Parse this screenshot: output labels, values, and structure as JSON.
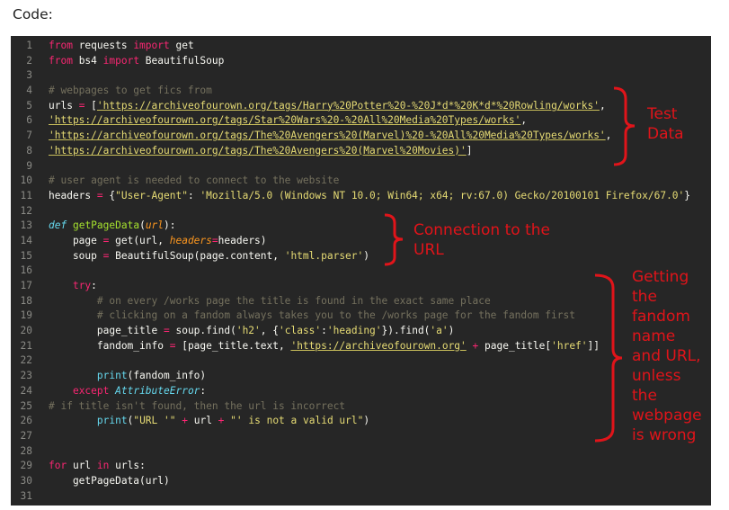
{
  "heading": "Code:",
  "code_lines": [
    [
      [
        "k",
        "from"
      ],
      [
        "t",
        " requests "
      ],
      [
        "k",
        "import"
      ],
      [
        "t",
        " get"
      ]
    ],
    [
      [
        "k",
        "from"
      ],
      [
        "t",
        " bs4 "
      ],
      [
        "k",
        "import"
      ],
      [
        "t",
        " BeautifulSoup"
      ]
    ],
    [],
    [
      [
        "c",
        "# webpages to get fics from"
      ]
    ],
    [
      [
        "t",
        "urls "
      ],
      [
        "k",
        "="
      ],
      [
        "t",
        " ["
      ],
      [
        "u",
        "'https://archiveofourown.org/tags/Harry%20Potter%20-%20J*d*%20K*d*%20Rowling/works'"
      ],
      [
        "t",
        ","
      ]
    ],
    [
      [
        "u",
        "'https://archiveofourown.org/tags/Star%20Wars%20-%20All%20Media%20Types/works'"
      ],
      [
        "t",
        ","
      ]
    ],
    [
      [
        "u",
        "'https://archiveofourown.org/tags/The%20Avengers%20(Marvel)%20-%20All%20Media%20Types/works'"
      ],
      [
        "t",
        ","
      ]
    ],
    [
      [
        "u",
        "'https://archiveofourown.org/tags/The%20Avengers%20(Marvel%20Movies)'"
      ],
      [
        "t",
        "]"
      ]
    ],
    [],
    [
      [
        "c",
        "# user agent is needed to connect to the website"
      ]
    ],
    [
      [
        "t",
        "headers "
      ],
      [
        "k",
        "="
      ],
      [
        "t",
        " {"
      ],
      [
        "s",
        "\"User-Agent\""
      ],
      [
        "t",
        ": "
      ],
      [
        "s",
        "'Mozilla/5.0 (Windows NT 10.0; Win64; x64; rv:67.0) Gecko/20100101 Firefox/67.0'"
      ],
      [
        "t",
        "}"
      ]
    ],
    [],
    [
      [
        "d",
        "def"
      ],
      [
        "t",
        " "
      ],
      [
        "f",
        "getPageData"
      ],
      [
        "t",
        "("
      ],
      [
        "p",
        "url"
      ],
      [
        "t",
        "):"
      ]
    ],
    [
      [
        "t",
        "    page "
      ],
      [
        "k",
        "="
      ],
      [
        "t",
        " get(url, "
      ],
      [
        "p",
        "headers"
      ],
      [
        "k",
        "="
      ],
      [
        "t",
        "headers)"
      ]
    ],
    [
      [
        "t",
        "    soup "
      ],
      [
        "k",
        "="
      ],
      [
        "t",
        " BeautifulSoup(page.content, "
      ],
      [
        "s",
        "'html.parser'"
      ],
      [
        "t",
        ")"
      ]
    ],
    [],
    [
      [
        "t",
        "    "
      ],
      [
        "k",
        "try"
      ],
      [
        "t",
        ":"
      ]
    ],
    [
      [
        "c",
        "        # on every /works page the title is found in the exact same place"
      ]
    ],
    [
      [
        "c",
        "        # clicking on a fandom always takes you to the /works page for the fandom first"
      ]
    ],
    [
      [
        "t",
        "        page_title "
      ],
      [
        "k",
        "="
      ],
      [
        "t",
        " soup.find("
      ],
      [
        "s",
        "'h2'"
      ],
      [
        "t",
        ", {"
      ],
      [
        "s",
        "'class'"
      ],
      [
        "t",
        ":"
      ],
      [
        "s",
        "'heading'"
      ],
      [
        "t",
        "}).find("
      ],
      [
        "s",
        "'a'"
      ],
      [
        "t",
        ")"
      ]
    ],
    [
      [
        "t",
        "        fandom_info "
      ],
      [
        "k",
        "="
      ],
      [
        "t",
        " [page_title.text, "
      ],
      [
        "u",
        "'https://archiveofourown.org'"
      ],
      [
        "t",
        " "
      ],
      [
        "k",
        "+"
      ],
      [
        "t",
        " page_title["
      ],
      [
        "s",
        "'href'"
      ],
      [
        "t",
        "]]"
      ]
    ],
    [],
    [
      [
        "t",
        "        "
      ],
      [
        "b",
        "print"
      ],
      [
        "t",
        "(fandom_info)"
      ]
    ],
    [
      [
        "t",
        "    "
      ],
      [
        "k",
        "except"
      ],
      [
        "t",
        " "
      ],
      [
        "i",
        "AttributeError"
      ],
      [
        "t",
        ":"
      ]
    ],
    [
      [
        "c",
        "# if title isn't found, then the url is incorrect"
      ]
    ],
    [
      [
        "t",
        "        "
      ],
      [
        "b",
        "print"
      ],
      [
        "t",
        "("
      ],
      [
        "s",
        "\"URL '\""
      ],
      [
        "t",
        " "
      ],
      [
        "k",
        "+"
      ],
      [
        "t",
        " url "
      ],
      [
        "k",
        "+"
      ],
      [
        "t",
        " "
      ],
      [
        "s",
        "\"' is not a valid url\""
      ],
      [
        "t",
        ")"
      ]
    ],
    [],
    [],
    [
      [
        "k",
        "for"
      ],
      [
        "t",
        " url "
      ],
      [
        "k",
        "in"
      ],
      [
        "t",
        " urls:"
      ]
    ],
    [
      [
        "t",
        "    getPageData(url)"
      ]
    ],
    []
  ],
  "annotations": {
    "test_data": [
      "Test",
      "Data"
    ],
    "connection": [
      "Connection to the",
      "URL"
    ],
    "getting": [
      "Getting",
      "the",
      "fandom",
      "name",
      "and URL,",
      "unless",
      "the",
      "webpage",
      "is wrong"
    ]
  },
  "colors": {
    "background": "#262626",
    "keyword": "#f92672",
    "string": "#e6db74",
    "comment": "#75715e",
    "annotation": "#e0141a"
  }
}
